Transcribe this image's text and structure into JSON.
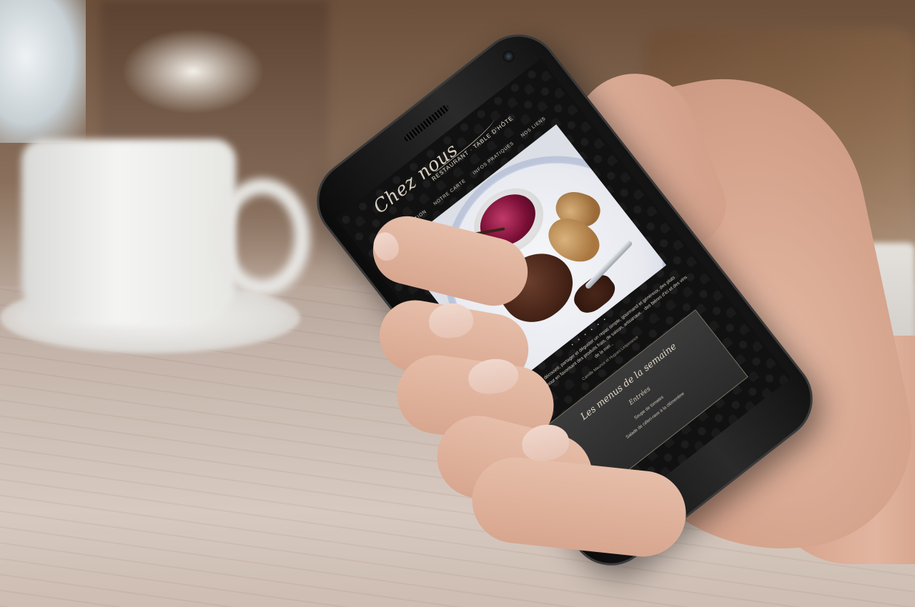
{
  "site": {
    "logo": "Chez nous",
    "subtitle": "RESTAURANT · TABLE D'HÔTE",
    "nav": [
      "PRÉSENTATION",
      "NOTRE CARTE",
      "INFOS PRATIQUES",
      "NOS LIENS"
    ]
  },
  "carousel": {
    "dots": "• • • • • •"
  },
  "intro": {
    "text": "Venez chez nous découvrir, partager et déguster un repas simple, gourmand et généreux, des plats confectionnés avec amour en favorisant des produits frais, de saison, artisanaux... des bières d'ici et des vins de la mer...",
    "author": "Camille Maurice et Hugues Lesperance"
  },
  "menu_box": {
    "title": "Les menus de la semaine",
    "section": "Entrées",
    "items": [
      "Soupe de tomates",
      "Salade de céleri-rave à la clémentine"
    ]
  }
}
